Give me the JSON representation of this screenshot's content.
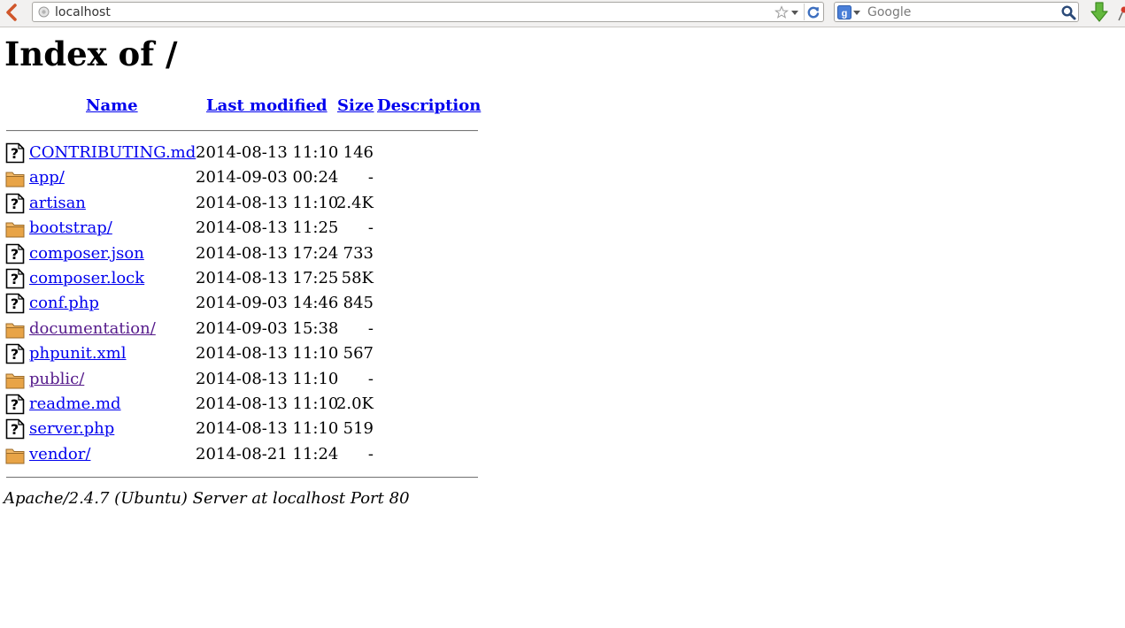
{
  "browser": {
    "url": "localhost",
    "search_placeholder": "Google"
  },
  "page": {
    "title": "Index of /",
    "columns": {
      "name": "Name",
      "last_modified": "Last modified",
      "size": "Size",
      "description": "Description"
    },
    "entries": [
      {
        "icon": "file-unknown-icon",
        "name": "CONTRIBUTING.md",
        "modified": "2014-08-13 11:10",
        "size": "146",
        "visited": false
      },
      {
        "icon": "folder-icon",
        "name": "app/",
        "modified": "2014-09-03 00:24",
        "size": "-",
        "visited": false
      },
      {
        "icon": "file-unknown-icon",
        "name": "artisan",
        "modified": "2014-08-13 11:10",
        "size": "2.4K",
        "visited": false
      },
      {
        "icon": "folder-icon",
        "name": "bootstrap/",
        "modified": "2014-08-13 11:25",
        "size": "-",
        "visited": false
      },
      {
        "icon": "file-unknown-icon",
        "name": "composer.json",
        "modified": "2014-08-13 17:24",
        "size": "733",
        "visited": false
      },
      {
        "icon": "file-unknown-icon",
        "name": "composer.lock",
        "modified": "2014-08-13 17:25",
        "size": "58K",
        "visited": false
      },
      {
        "icon": "file-unknown-icon",
        "name": "conf.php",
        "modified": "2014-09-03 14:46",
        "size": "845",
        "visited": false
      },
      {
        "icon": "folder-icon",
        "name": "documentation/",
        "modified": "2014-09-03 15:38",
        "size": "-",
        "visited": true
      },
      {
        "icon": "file-unknown-icon",
        "name": "phpunit.xml",
        "modified": "2014-08-13 11:10",
        "size": "567",
        "visited": false
      },
      {
        "icon": "folder-icon",
        "name": "public/",
        "modified": "2014-08-13 11:10",
        "size": "-",
        "visited": true
      },
      {
        "icon": "file-unknown-icon",
        "name": "readme.md",
        "modified": "2014-08-13 11:10",
        "size": "2.0K",
        "visited": false
      },
      {
        "icon": "file-unknown-icon",
        "name": "server.php",
        "modified": "2014-08-13 11:10",
        "size": "519",
        "visited": false
      },
      {
        "icon": "folder-icon",
        "name": "vendor/",
        "modified": "2014-08-21 11:24",
        "size": "-",
        "visited": false
      }
    ],
    "footer": "Apache/2.4.7 (Ubuntu) Server at localhost Port 80"
  },
  "colors": {
    "link": "#0000ee",
    "visited_link": "#551a8b",
    "folder": "#e8a447"
  }
}
